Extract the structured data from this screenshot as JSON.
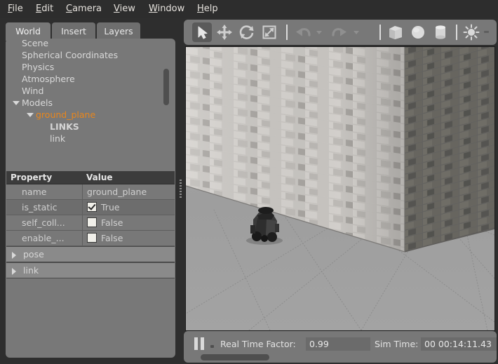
{
  "menu": {
    "items": [
      {
        "label": "File",
        "accel": "F"
      },
      {
        "label": "Edit",
        "accel": "E"
      },
      {
        "label": "Camera",
        "accel": "C"
      },
      {
        "label": "View",
        "accel": "V"
      },
      {
        "label": "Window",
        "accel": "W"
      },
      {
        "label": "Help",
        "accel": "H"
      }
    ]
  },
  "left_dock": {
    "tabs": [
      {
        "label": "World",
        "active": true
      },
      {
        "label": "Insert",
        "active": false
      },
      {
        "label": "Layers",
        "active": false
      }
    ],
    "tree": [
      {
        "label": "Scene",
        "indent": 0,
        "arrow": "none",
        "style": "normal"
      },
      {
        "label": "Spherical Coordinates",
        "indent": 0,
        "arrow": "none",
        "style": "normal"
      },
      {
        "label": "Physics",
        "indent": 0,
        "arrow": "none",
        "style": "normal"
      },
      {
        "label": "Atmosphere",
        "indent": 0,
        "arrow": "none",
        "style": "normal"
      },
      {
        "label": "Wind",
        "indent": 0,
        "arrow": "none",
        "style": "normal"
      },
      {
        "label": "Models",
        "indent": 0,
        "arrow": "down",
        "style": "normal"
      },
      {
        "label": "ground_plane",
        "indent": 1,
        "arrow": "down",
        "style": "selected"
      },
      {
        "label": "LINKS",
        "indent": 2,
        "arrow": "none",
        "style": "bold"
      },
      {
        "label": "link",
        "indent": 2,
        "arrow": "none",
        "style": "normal"
      }
    ],
    "property_table": {
      "headers": {
        "property": "Property",
        "value": "Value"
      },
      "rows": [
        {
          "property": "name",
          "value": "ground_plane",
          "type": "text",
          "group": false
        },
        {
          "property": "is_static",
          "value": "True",
          "type": "checkbox",
          "checked": true,
          "group": false
        },
        {
          "property": "self_coll...",
          "value": "False",
          "type": "checkbox",
          "checked": false,
          "group": false
        },
        {
          "property": "enable_...",
          "value": "False",
          "type": "checkbox",
          "checked": false,
          "group": false
        },
        {
          "property": "pose",
          "value": "",
          "type": "group",
          "group": true
        },
        {
          "property": "link",
          "value": "",
          "type": "group",
          "group": true
        }
      ]
    }
  },
  "toolbar": {
    "buttons": [
      {
        "name": "select-tool",
        "icon": "cursor-arrow-icon",
        "active": true,
        "enabled": true
      },
      {
        "name": "translate-tool",
        "icon": "move-arrows-icon",
        "active": false,
        "enabled": true
      },
      {
        "name": "rotate-tool",
        "icon": "rotate-icon",
        "active": false,
        "enabled": true
      },
      {
        "name": "scale-tool",
        "icon": "scale-icon",
        "active": false,
        "enabled": true
      },
      {
        "name": "undo-button",
        "icon": "undo-arrow-icon",
        "active": false,
        "enabled": false
      },
      {
        "name": "redo-button",
        "icon": "redo-arrow-icon",
        "active": false,
        "enabled": false
      },
      {
        "name": "insert-box",
        "icon": "box-icon",
        "active": false,
        "enabled": true
      },
      {
        "name": "insert-sphere",
        "icon": "sphere-icon",
        "active": false,
        "enabled": true
      },
      {
        "name": "insert-cylinder",
        "icon": "cylinder-icon",
        "active": false,
        "enabled": true
      },
      {
        "name": "insert-light",
        "icon": "sun-light-icon",
        "active": false,
        "enabled": true
      }
    ],
    "overflow_label": "··"
  },
  "viewport": {
    "scene_name": "brick-room-with-robot",
    "objects": [
      {
        "name": "ground-plane",
        "description": "light gray tiled floor with grid lines"
      },
      {
        "name": "brick-wall-left",
        "description": "light gray brick wall in perspective"
      },
      {
        "name": "brick-wall-right",
        "description": "darker shaded brick wall"
      },
      {
        "name": "robot-model",
        "description": "dark tracked robot on the floor"
      }
    ]
  },
  "status_bar": {
    "pause_label": "pause",
    "real_time_factor_label": "Real Time Factor:",
    "real_time_factor_value": "0.99",
    "sim_time_label": "Sim Time:",
    "sim_time_value": "00 00:14:11.43"
  },
  "colors": {
    "accent_selected": "#e8861c",
    "panel_bg": "#787878",
    "window_bg": "#2e2e2e",
    "header_bg": "#3c3c3c"
  }
}
